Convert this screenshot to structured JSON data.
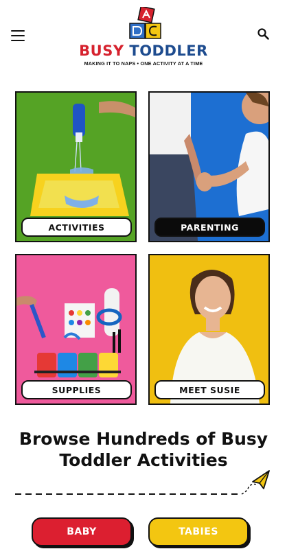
{
  "header": {
    "brand_first": "BUSY",
    "brand_second": "TODDLER",
    "tagline": "MAKING IT TO NAPS • ONE ACTIVITY AT A TIME",
    "menu_icon": "hamburger-menu-icon",
    "search_icon": "search-icon"
  },
  "tiles": [
    {
      "label": "ACTIVITIES",
      "bg": "#55a325"
    },
    {
      "label": "PARENTING",
      "bg": "#1d6fd2"
    },
    {
      "label": "SUPPLIES",
      "bg": "#ef5a9c"
    },
    {
      "label": "MEET SUSIE",
      "bg": "#f0bf11"
    }
  ],
  "browse": {
    "title": "Browse Hundreds of Busy Toddler Activities",
    "decor_icon": "paper-plane-icon"
  },
  "buttons": {
    "baby": "BABY",
    "tabies": "TABIES"
  },
  "colors": {
    "brand_red": "#d6222e",
    "brand_blue": "#1e4c8f",
    "brand_yellow": "#f3c611"
  }
}
